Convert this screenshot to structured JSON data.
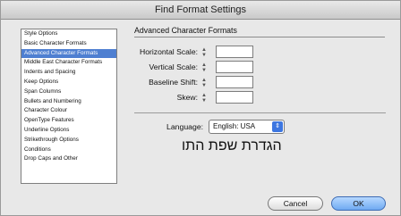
{
  "window": {
    "title": "Find Format Settings"
  },
  "sidebar": {
    "items": [
      {
        "label": "Style Options"
      },
      {
        "label": "Basic Character Formats"
      },
      {
        "label": "Advanced Character Formats"
      },
      {
        "label": "Middle East Character Formats"
      },
      {
        "label": "Indents and Spacing"
      },
      {
        "label": "Keep Options"
      },
      {
        "label": "Span Columns"
      },
      {
        "label": "Bullets and Numbering"
      },
      {
        "label": "Character Colour"
      },
      {
        "label": "OpenType Features"
      },
      {
        "label": "Underline Options"
      },
      {
        "label": "Strikethrough Options"
      },
      {
        "label": "Conditions"
      },
      {
        "label": "Drop Caps and Other"
      }
    ]
  },
  "main": {
    "section_title": "Advanced Character Formats",
    "fields": [
      {
        "label": "Horizontal Scale:",
        "value": ""
      },
      {
        "label": "Vertical Scale:",
        "value": ""
      },
      {
        "label": "Baseline Shift:",
        "value": ""
      },
      {
        "label": "Skew:",
        "value": ""
      }
    ],
    "language_label": "Language:",
    "language_value": "English: USA",
    "hebrew_text": "הגדרת שפת התו"
  },
  "buttons": {
    "cancel": "Cancel",
    "ok": "OK"
  },
  "colors": {
    "selection": "#4e7fd1",
    "ok_button": "#6faaf2",
    "select_arrow": "#3d76e0"
  }
}
